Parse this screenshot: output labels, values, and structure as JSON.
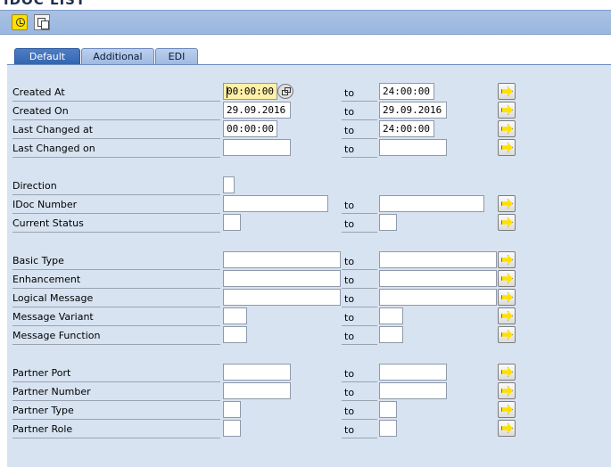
{
  "window": {
    "title": "IDOC LIST"
  },
  "toolbar": {
    "icons": [
      "execute-icon",
      "copy-icon"
    ]
  },
  "tabs": [
    {
      "label": "Default",
      "active": true
    },
    {
      "label": "Additional",
      "active": false
    },
    {
      "label": "EDI",
      "active": false
    }
  ],
  "to_label": "to",
  "fields": {
    "created_at": {
      "label": "Created At",
      "from": "00:00:00",
      "to": "24:00:00"
    },
    "created_on": {
      "label": "Created On",
      "from": "29.09.2016",
      "to": "29.09.2016"
    },
    "last_changed_at": {
      "label": "Last Changed at",
      "from": "00:00:00",
      "to": "24:00:00"
    },
    "last_changed_on": {
      "label": "Last Changed on",
      "from": "",
      "to": ""
    },
    "direction": {
      "label": "Direction",
      "value": ""
    },
    "idoc_number": {
      "label": "IDoc Number",
      "from": "",
      "to": ""
    },
    "current_status": {
      "label": "Current Status",
      "from": "",
      "to": ""
    },
    "basic_type": {
      "label": "Basic Type",
      "from": "",
      "to": ""
    },
    "enhancement": {
      "label": "Enhancement",
      "from": "",
      "to": ""
    },
    "logical_message": {
      "label": "Logical Message",
      "from": "",
      "to": ""
    },
    "message_variant": {
      "label": "Message Variant",
      "from": "",
      "to": ""
    },
    "message_function": {
      "label": "Message Function",
      "from": "",
      "to": ""
    },
    "partner_port": {
      "label": "Partner Port",
      "from": "",
      "to": ""
    },
    "partner_number": {
      "label": "Partner Number",
      "from": "",
      "to": ""
    },
    "partner_type": {
      "label": "Partner Type",
      "from": "",
      "to": ""
    },
    "partner_role": {
      "label": "Partner Role",
      "from": "",
      "to": ""
    }
  },
  "colors": {
    "accent": "#ffe100",
    "toolbar": "#9ab7df",
    "panel": "#d7e3f1",
    "tab_active": "#3266b0"
  }
}
